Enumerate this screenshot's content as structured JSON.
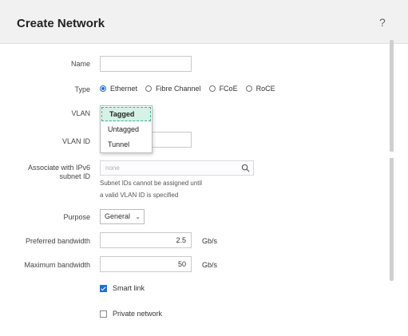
{
  "dialog": {
    "title": "Create Network",
    "help_label": "?"
  },
  "form": {
    "name": {
      "label": "Name",
      "value": ""
    },
    "type": {
      "label": "Type",
      "options": [
        "Ethernet",
        "Fibre Channel",
        "FCoE",
        "RoCE"
      ],
      "selected": "Ethernet"
    },
    "vlan": {
      "label": "VLAN",
      "options": [
        "Tagged",
        "Untagged",
        "Tunnel"
      ],
      "selected": "Tagged"
    },
    "vlan_id": {
      "label": "VLAN ID",
      "value": ""
    },
    "ipv6_subnet": {
      "label_line1": "Associate with IPv6",
      "label_line2": "subnet ID",
      "placeholder": "none",
      "helper_line1": "Subnet IDs cannot be assigned until",
      "helper_line2": "a valid VLAN ID is specified"
    },
    "purpose": {
      "label": "Purpose",
      "value": "General"
    },
    "preferred_bandwidth": {
      "label": "Preferred bandwidth",
      "value": "2.5",
      "unit": "Gb/s"
    },
    "maximum_bandwidth": {
      "label": "Maximum bandwidth",
      "value": "50",
      "unit": "Gb/s"
    },
    "smart_link": {
      "label": "Smart link",
      "checked": true
    },
    "private_network": {
      "label": "Private network",
      "checked": false
    }
  },
  "icons": {
    "search": "search-icon",
    "help": "help-icon",
    "chevron": "chevron-down-icon"
  },
  "colors": {
    "accent": "#1e6fd9",
    "selected_option_bg": "#d5f2e6",
    "selected_option_border": "#35b183",
    "header_bg": "#f1f1f1"
  }
}
